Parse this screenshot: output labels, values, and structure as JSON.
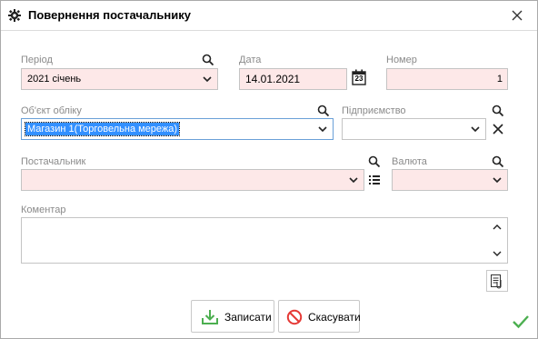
{
  "window": {
    "title": "Повернення постачальнику"
  },
  "form": {
    "period": {
      "label": "Період",
      "value": "2021 січень"
    },
    "date": {
      "label": "Дата",
      "value": "14.01.2021",
      "calendar_day": "23"
    },
    "number": {
      "label": "Номер",
      "value": "1"
    },
    "account_object": {
      "label": "Об'єкт обліку",
      "value": "Магазин 1(Торговельна мережа)"
    },
    "enterprise": {
      "label": "Підприємство",
      "value": ""
    },
    "supplier": {
      "label": "Постачальник",
      "value": ""
    },
    "currency": {
      "label": "Валюта",
      "value": ""
    },
    "comment": {
      "label": "Коментар",
      "value": ""
    }
  },
  "buttons": {
    "save_label": "Записати",
    "cancel_label": "Скасувати"
  },
  "colors": {
    "required_bg": "#fde8e8",
    "selected_bg": "#3390ff",
    "accent_green": "#4caf50",
    "cancel_red": "#e53935"
  }
}
